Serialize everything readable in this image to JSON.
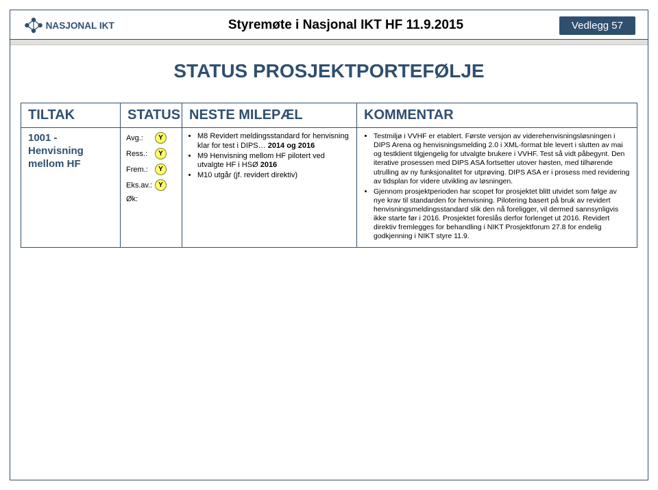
{
  "header": {
    "logo_text": "NASJONAL IKT",
    "title": "Styremøte i Nasjonal IKT HF 11.9.2015",
    "badge": "Vedlegg 57"
  },
  "main_title": "STATUS PROSJEKTPORTEFØLJE",
  "table": {
    "headers": {
      "tiltak": "TILTAK",
      "status": "STATUS",
      "neste": "NESTE MILEPÆL",
      "kommentar": "KOMMENTAR"
    },
    "row": {
      "tiltak": "1001 - Henvisning mellom HF",
      "status": [
        {
          "label": "Avg.:",
          "value": "Y"
        },
        {
          "label": "Ress.:",
          "value": "Y"
        },
        {
          "label": "Frem.:",
          "value": "Y"
        },
        {
          "label": "Eks.av.:",
          "value": "Y"
        },
        {
          "label": "Øk:",
          "value": ""
        }
      ],
      "neste_parts": {
        "m8_prefix": "M8 Revidert meldingsstandard for henvisning klar for test i DIPS… ",
        "m8_bold": "2014 og 2016",
        "m9_prefix": "M9 Henvisning mellom HF pilotert ved utvalgte HF i HSØ ",
        "m9_bold": "2016",
        "m10": "M10 utgår (jf. revidert direktiv)"
      },
      "kommentar": [
        "Testmiljø i VVHF er etablert. Første versjon av viderehenvisningsløsningen i DIPS Arena og henvisningsmelding 2.0 i XML-format ble levert i slutten av mai og testklient tilgjengelig for utvalgte brukere i VVHF. Test så vidt påbegynt. Den iterative prosessen med DIPS ASA fortsetter utover høsten, med tilhørende utrulling av ny funksjonalitet for utprøving. DIPS ASA er i prosess med revidering av tidsplan for videre utvikling av løsningen.",
        "Gjennom prosjektperioden har scopet for prosjektet blitt utvidet som følge av nye krav til standarden for henvisning. Pilotering basert på bruk av revidert henvisningsmeldingsstandard slik den nå foreligger, vil dermed sannsynligvis ikke starte før i 2016. Prosjektet foreslås derfor forlenget ut 2016. Revidert direktiv fremlegges for behandling i NIKT Prosjektforum 27.8 for endelig godkjenning i NIKT styre 11.9."
      ]
    }
  }
}
